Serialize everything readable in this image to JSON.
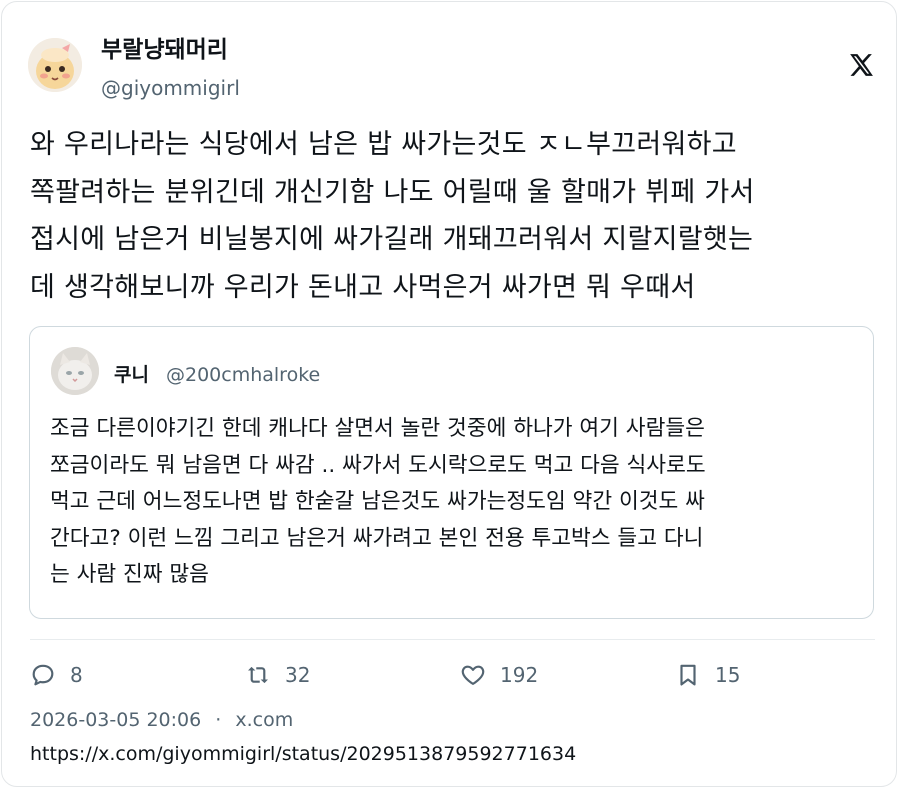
{
  "author": {
    "display_name": "부랄냥돼머리",
    "handle": "@giyommigirl"
  },
  "tweet": {
    "lines": [
      "와 우리나라는 식당에서 남은 밥 싸가는것도 ㅈㄴ부끄러워하고",
      "쪽팔려하는 분위긴데 개신기함 나도 어릴때 울 할매가 뷔페 가서",
      "접시에 남은거 비닐봉지에 싸가길래 개돼끄러워서 지랄지랄햇는",
      "데 생각해보니까 우리가 돈내고 사먹은거 싸가면 뭐 우때서"
    ]
  },
  "quoted": {
    "display_name": "쿠니",
    "handle": "@200cmhalroke",
    "lines": [
      "조금 다른이야기긴 한데 캐나다 살면서 놀란 것중에 하나가 여기 사람들은",
      "쪼금이라도 뭐 남음면 다 싸감 .. 싸가서 도시락으로도 먹고 다음 식사로도",
      "먹고 근데 어느정도나면 밥 한숟갈 남은것도 싸가는정도임 약간 이것도 싸",
      "간다고? 이런 느낌 그리고 남은거 싸가려고 본인 전용 투고박스 들고 다니",
      "는 사람 진짜 많음"
    ]
  },
  "stats": {
    "replies": "8",
    "retweets": "32",
    "likes": "192",
    "bookmarks": "15"
  },
  "meta": {
    "timestamp": "2026-03-05 20:06",
    "separator": "·",
    "source": "x.com",
    "url": "https://x.com/giyommigirl/status/2029513879592771634"
  },
  "icons": {
    "logo": "x-logo-icon",
    "reply": "reply-icon",
    "retweet": "retweet-icon",
    "like": "heart-icon",
    "bookmark": "bookmark-icon"
  },
  "colors": {
    "text": "#0f1419",
    "secondary": "#536471",
    "border": "#cfd9de"
  }
}
